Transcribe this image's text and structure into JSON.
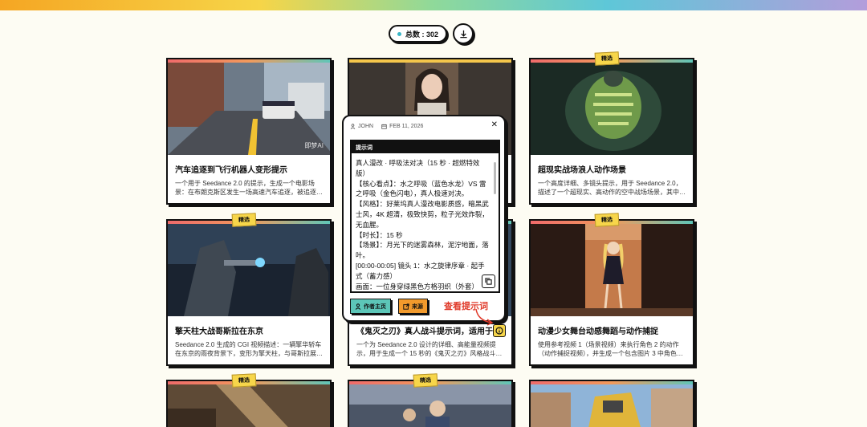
{
  "header": {
    "count_label": "总数 : 302",
    "download_icon": "download-icon"
  },
  "badge_label": "精选",
  "cards": [
    {
      "title": "汽车追逐到飞行机器人变形提示",
      "desc": "一个用于 Seedance 2.0 的提示，生成一个电影场景：在布朗克斯区发生一场高速汽车追逐，被追逐…",
      "watermark": "即梦AI"
    },
    {
      "title": "",
      "desc": ""
    },
    {
      "title": "超现实战场浪人动作场景",
      "desc": "一个高度详细、多镜头提示，用于 Seedance 2.0，描述了一个超现实、高动作的空中战场场景，其中…"
    },
    {
      "title": "擎天柱大战哥斯拉在东京",
      "desc": "Seedance 2.0 生成的 CGI 视频描述：一辆擎华轿车在东京的雨夜背景下，变形为擎天柱，与哥斯拉展…"
    },
    {
      "title": "《鬼灭之刃》真人战斗提示词，适用于…",
      "desc": "一个为 Seedance 2.0 设计的详细、高能量视频提示，用于生成一个 15 秒的《鬼灭之刃》风格战斗…"
    },
    {
      "title": "动漫少女舞台动感舞蹈与动作捕捉",
      "desc": "使用参考视频 1（场景视频）来执行角色 2 的动作（动作捕捉视频），并生成一个包含图片 3 中角色…"
    }
  ],
  "popup": {
    "author": "JOHN",
    "date": "FEB 11, 2026",
    "prompt_header": "提示词",
    "prompt_text": "真人漫改 · 呼吸法对决（15 秒 · 超燃特效版）\n【核心看点】：水之呼吸（蓝色水龙）VS 雷之呼吸（金色闪电），真人极速对决。\n【风格】：好莱坞真人漫改电影质感，暗黑武士风，4K 超清，极致快剪，粒子光效炸裂，无血腥。\n【时长】：15 秒\n【场景】：月光下的迷雾森林，泥泞地面，落叶。\n[00:00-00:05] 镜头 1：水之旋律序章 · 起手式（蓄力感）\n画面：一位身穿绿黑色方格羽织（外套）",
    "author_button": "作者主页",
    "source_button": "来源"
  },
  "annotation": "查看提示词",
  "colors": {
    "accent_yellow": "#f7d64a",
    "accent_teal": "#3ab6c7",
    "author_button_bg": "#5cc6b8",
    "source_button_bg": "#f29a2c",
    "annotation_red": "#e03a2a"
  }
}
